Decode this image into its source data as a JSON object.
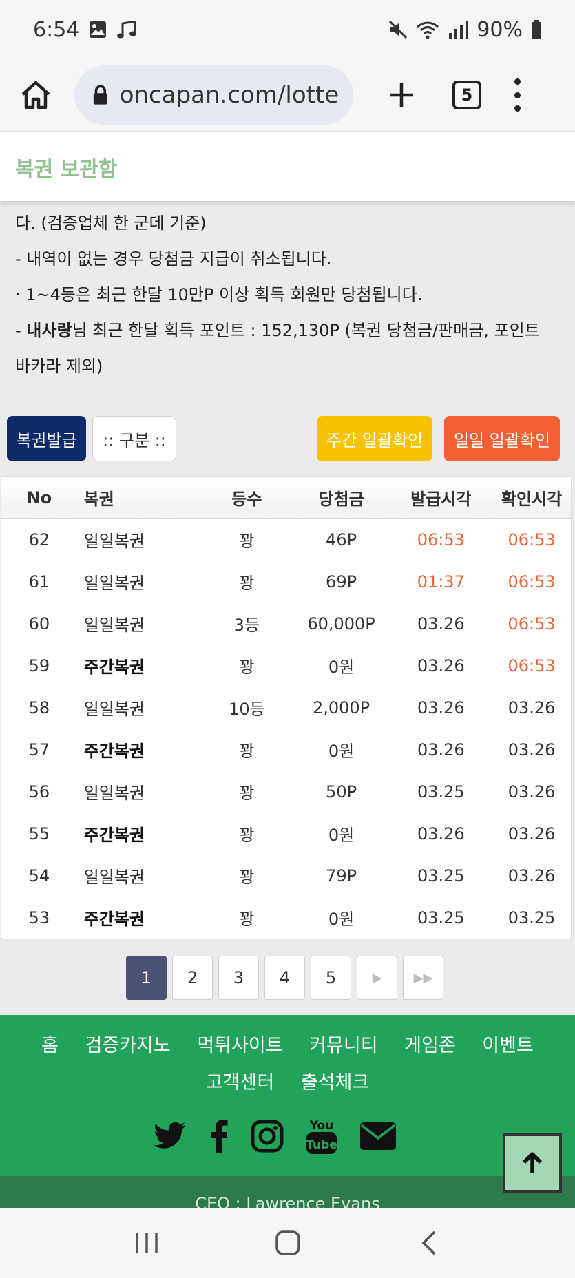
{
  "status_bar": {
    "time": "6:54",
    "battery": "90%"
  },
  "browser": {
    "url": "oncapan.com/lottery",
    "tab_count": "5"
  },
  "page": {
    "title": "복권 보관함"
  },
  "notice": {
    "line1": "다. (검증업체 한 군데 기준)",
    "line2": " - 내역이 없는 경우 당첨금 지급이 취소됩니다.",
    "line3": "· 1~4등은 최근 한달 10만P 이상 획득 회원만 당첨됩니다.",
    "line4_prefix": " - ",
    "line4_user": "내사랑",
    "line4_rest": "님 최근 한달 획득 포인트 : 152,130P (복권 당첨금/판매금, 포인트 바카라 제외)"
  },
  "buttons": {
    "issue": "복권발급",
    "category": ":: 구분 ::",
    "weekly_check": "주간 일괄확인",
    "daily_check": "일일 일괄확인"
  },
  "table": {
    "headers": {
      "no": "No",
      "name": "복권",
      "rank": "등수",
      "prize": "당첨금",
      "issued": "발급시각",
      "checked": "확인시각"
    },
    "rows": [
      {
        "no": "62",
        "name": "일일복권",
        "rank": "꽝",
        "prize": "46P",
        "issued": "06:53",
        "checked": "06:53"
      },
      {
        "no": "61",
        "name": "일일복권",
        "rank": "꽝",
        "prize": "69P",
        "issued": "01:37",
        "checked": "06:53"
      },
      {
        "no": "60",
        "name": "일일복권",
        "rank": "3등",
        "prize": "60,000P",
        "issued": "03.26",
        "checked": "06:53"
      },
      {
        "no": "59",
        "name": "주간복권",
        "rank": "꽝",
        "prize": "0원",
        "issued": "03.26",
        "checked": "06:53"
      },
      {
        "no": "58",
        "name": "일일복권",
        "rank": "10등",
        "prize": "2,000P",
        "issued": "03.26",
        "checked": "03.26"
      },
      {
        "no": "57",
        "name": "주간복권",
        "rank": "꽝",
        "prize": "0원",
        "issued": "03.26",
        "checked": "03.26"
      },
      {
        "no": "56",
        "name": "일일복권",
        "rank": "꽝",
        "prize": "50P",
        "issued": "03.25",
        "checked": "03.26"
      },
      {
        "no": "55",
        "name": "주간복권",
        "rank": "꽝",
        "prize": "0원",
        "issued": "03.26",
        "checked": "03.26"
      },
      {
        "no": "54",
        "name": "일일복권",
        "rank": "꽝",
        "prize": "79P",
        "issued": "03.25",
        "checked": "03.26"
      },
      {
        "no": "53",
        "name": "주간복권",
        "rank": "꽝",
        "prize": "0원",
        "issued": "03.25",
        "checked": "03.25"
      }
    ]
  },
  "pagination": {
    "pages": [
      "1",
      "2",
      "3",
      "4",
      "5"
    ],
    "next": "▶",
    "last": "▶▶"
  },
  "footer": {
    "links": [
      "홈",
      "검증카지노",
      "먹튀사이트",
      "커뮤니티",
      "게임존",
      "이벤트",
      "고객센터",
      "출석체크"
    ],
    "ceo": "CEO : Lawrence Evans",
    "colors": {
      "footer_bg": "#21a359",
      "accent_orange": "#e8673c",
      "active_page": "#4c5276"
    }
  }
}
